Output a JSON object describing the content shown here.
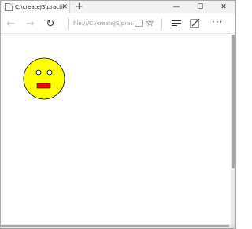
{
  "tab": {
    "title": "C:\\createJS\\practic",
    "close": "✕"
  },
  "new_tab": "+",
  "window_controls": {
    "minimize": "—",
    "maximize": "☐",
    "close": "✕"
  },
  "nav": {
    "back": "←",
    "forward": "→",
    "refresh": "↻"
  },
  "address": {
    "value": "file:///C:/createJS/prac"
  },
  "toolbar": {
    "favorite": "☆",
    "more": "···"
  },
  "face": {
    "fill": "#ffff00",
    "mouth_color": "#ff0000",
    "stroke": "#000000"
  }
}
